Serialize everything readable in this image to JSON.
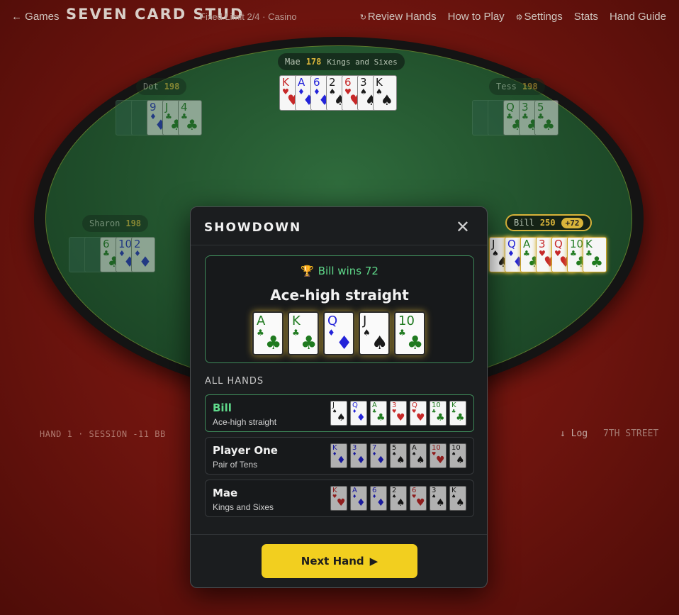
{
  "topbar": {
    "back_label": "← Games",
    "title": "SEVEN CARD STUD",
    "subtitle": "Fixed Limit 2/4 · Casino",
    "nav": {
      "review_icon": "↻",
      "review": "Review Hands",
      "how_to_play": "How to Play",
      "settings_icon": "⚙",
      "settings": "Settings",
      "stats": "Stats",
      "hand_guide": "Hand Guide"
    }
  },
  "seats": {
    "mae": {
      "name": "Mae",
      "stack": "178",
      "hand_desc": "Kings and Sixes"
    },
    "dot": {
      "name": "Dot",
      "stack": "198"
    },
    "tess": {
      "name": "Tess",
      "stack": "198"
    },
    "sharon": {
      "name": "Sharon",
      "stack": "198"
    },
    "bill": {
      "name": "Bill",
      "stack": "250",
      "won": "+72"
    }
  },
  "table_cards": {
    "mae": [
      {
        "rank": "K",
        "suit": "♥",
        "color": "red"
      },
      {
        "rank": "A",
        "suit": "♦",
        "color": "blue"
      },
      {
        "rank": "6",
        "suit": "♦",
        "color": "blue"
      },
      {
        "rank": "2",
        "suit": "♠",
        "color": "black"
      },
      {
        "rank": "6",
        "suit": "♥",
        "color": "red"
      },
      {
        "rank": "3",
        "suit": "♠",
        "color": "black"
      },
      {
        "rank": "K",
        "suit": "♠",
        "color": "black"
      }
    ],
    "dot": [
      {
        "rank": "9",
        "suit": "♦",
        "color": "blue"
      },
      {
        "rank": "J",
        "suit": "♣",
        "color": "green"
      },
      {
        "rank": "4",
        "suit": "♣",
        "color": "green"
      }
    ],
    "tess": [
      {
        "rank": "Q",
        "suit": "♣",
        "color": "green"
      },
      {
        "rank": "3",
        "suit": "♣",
        "color": "green"
      },
      {
        "rank": "5",
        "suit": "♣",
        "color": "green"
      }
    ],
    "sharon": [
      {
        "rank": "6",
        "suit": "♣",
        "color": "green"
      },
      {
        "rank": "10",
        "suit": "♦",
        "color": "blue"
      },
      {
        "rank": "2",
        "suit": "♦",
        "color": "blue"
      }
    ],
    "bill": [
      {
        "rank": "J",
        "suit": "♠",
        "color": "black"
      },
      {
        "rank": "Q",
        "suit": "♦",
        "color": "blue"
      },
      {
        "rank": "A",
        "suit": "♣",
        "color": "green"
      },
      {
        "rank": "3",
        "suit": "♥",
        "color": "red"
      },
      {
        "rank": "Q",
        "suit": "♥",
        "color": "red"
      },
      {
        "rank": "10",
        "suit": "♣",
        "color": "green"
      },
      {
        "rank": "K",
        "suit": "♣",
        "color": "green"
      }
    ]
  },
  "footer": {
    "hand_info": "HAND 1 · SESSION -11 BB",
    "log_label": "↓ Log",
    "street": "7TH STREET"
  },
  "modal": {
    "title": "SHOWDOWN",
    "close_icon": "✕",
    "trophy_icon": "🏆",
    "winner_text": "Bill wins 72",
    "winning_hand": "Ace-high straight",
    "best_cards": [
      {
        "rank": "A",
        "suit": "♣",
        "color": "green"
      },
      {
        "rank": "K",
        "suit": "♣",
        "color": "green"
      },
      {
        "rank": "Q",
        "suit": "♦",
        "color": "blue"
      },
      {
        "rank": "J",
        "suit": "♠",
        "color": "black"
      },
      {
        "rank": "10",
        "suit": "♣",
        "color": "green"
      }
    ],
    "all_hands_label": "ALL HANDS",
    "results": [
      {
        "name": "Bill",
        "hand": "Ace-high straight",
        "cards": [
          {
            "rank": "J",
            "suit": "♠",
            "color": "black"
          },
          {
            "rank": "Q",
            "suit": "♦",
            "color": "blue"
          },
          {
            "rank": "A",
            "suit": "♣",
            "color": "green"
          },
          {
            "rank": "3",
            "suit": "♥",
            "color": "red"
          },
          {
            "rank": "Q",
            "suit": "♥",
            "color": "red"
          },
          {
            "rank": "10",
            "suit": "♣",
            "color": "green"
          },
          {
            "rank": "K",
            "suit": "♣",
            "color": "green"
          }
        ]
      },
      {
        "name": "Player One",
        "hand": "Pair of Tens",
        "cards": [
          {
            "rank": "K",
            "suit": "♦",
            "color": "blue"
          },
          {
            "rank": "3",
            "suit": "♦",
            "color": "blue"
          },
          {
            "rank": "7",
            "suit": "♦",
            "color": "blue"
          },
          {
            "rank": "5",
            "suit": "♠",
            "color": "black"
          },
          {
            "rank": "A",
            "suit": "♠",
            "color": "black"
          },
          {
            "rank": "10",
            "suit": "♥",
            "color": "red"
          },
          {
            "rank": "10",
            "suit": "♠",
            "color": "black"
          }
        ]
      },
      {
        "name": "Mae",
        "hand": "Kings and Sixes",
        "cards": [
          {
            "rank": "K",
            "suit": "♥",
            "color": "red"
          },
          {
            "rank": "A",
            "suit": "♦",
            "color": "blue"
          },
          {
            "rank": "6",
            "suit": "♦",
            "color": "blue"
          },
          {
            "rank": "2",
            "suit": "♠",
            "color": "black"
          },
          {
            "rank": "6",
            "suit": "♥",
            "color": "red"
          },
          {
            "rank": "3",
            "suit": "♠",
            "color": "black"
          },
          {
            "rank": "K",
            "suit": "♠",
            "color": "black"
          }
        ]
      }
    ],
    "next_button": "Next Hand",
    "next_icon": "▶"
  },
  "colors": {
    "felt": "#1f4d2a",
    "accent_gold": "#f2cf1f",
    "win_green": "#5fd98a",
    "card_red": "#c62828",
    "card_blue": "#2323d9",
    "card_green": "#1f7a1f"
  }
}
